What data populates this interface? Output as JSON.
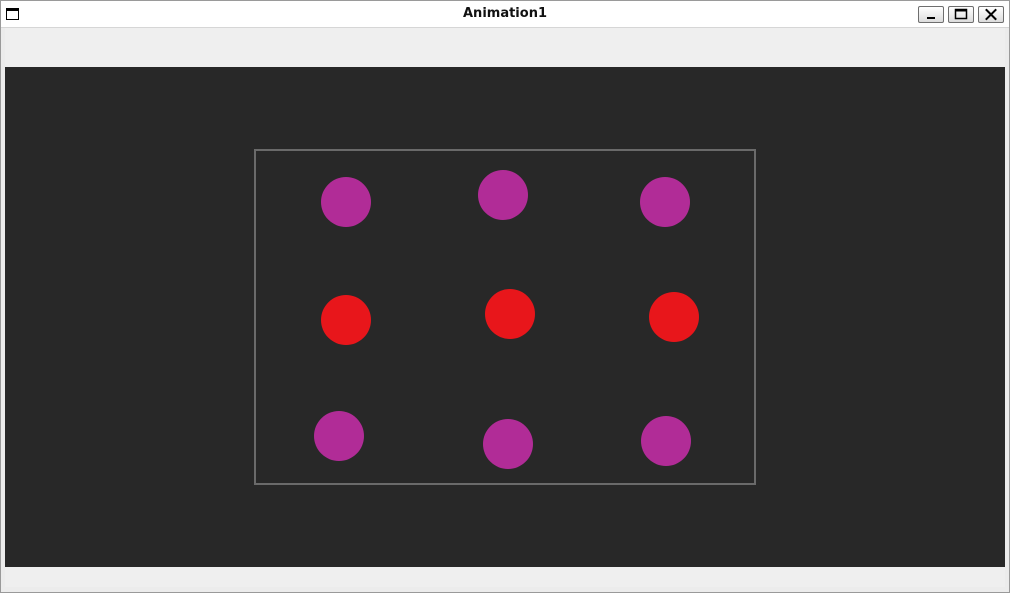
{
  "window": {
    "title": "Animation1"
  },
  "colors": {
    "canvas_background": "#282828",
    "frame_stroke": "#6a6a6a",
    "dot_magenta": "#b12c97",
    "dot_red": "#e8161b"
  },
  "icons": {
    "app": "window-icon",
    "minimize": "minimize-icon",
    "maximize": "maximize-icon",
    "close": "close-icon"
  },
  "dots": [
    {
      "id": "dot-1",
      "color": "magenta"
    },
    {
      "id": "dot-2",
      "color": "magenta"
    },
    {
      "id": "dot-3",
      "color": "magenta"
    },
    {
      "id": "dot-4",
      "color": "red"
    },
    {
      "id": "dot-5",
      "color": "red"
    },
    {
      "id": "dot-6",
      "color": "red"
    },
    {
      "id": "dot-7",
      "color": "magenta"
    },
    {
      "id": "dot-8",
      "color": "magenta"
    },
    {
      "id": "dot-9",
      "color": "magenta"
    }
  ]
}
